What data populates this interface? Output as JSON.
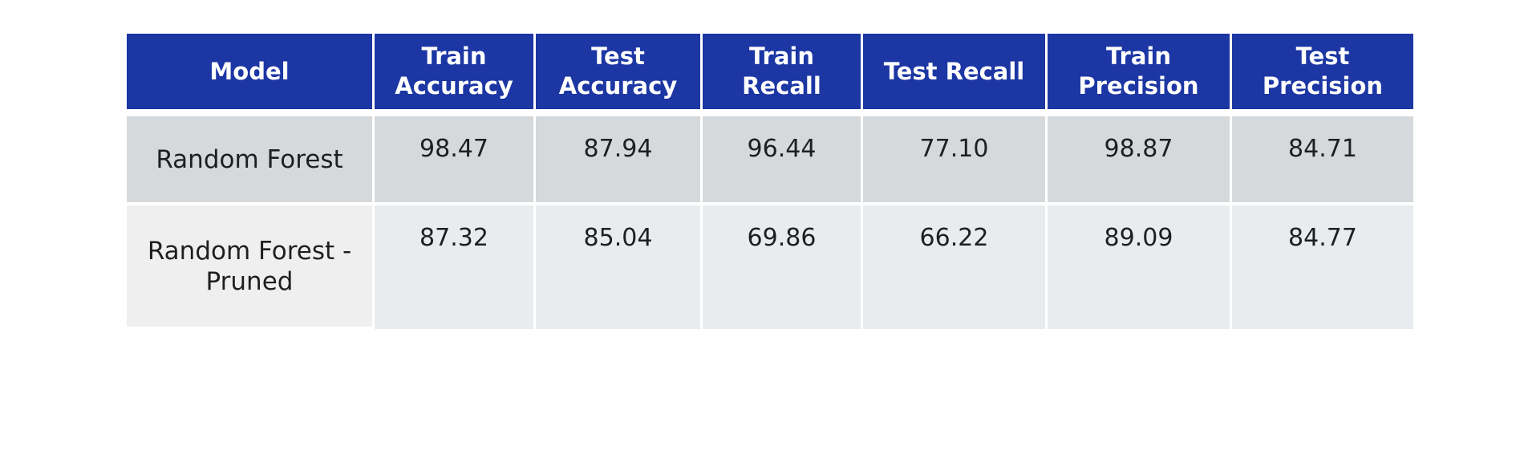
{
  "table": {
    "headers": [
      "Model",
      "Train\nAccuracy",
      "Test\nAccuracy",
      "Train\nRecall",
      "Test Recall",
      "Train\nPrecision",
      "Test\nPrecision"
    ],
    "rows": [
      {
        "model": "Random Forest",
        "values": [
          "98.47",
          "87.94",
          "96.44",
          "77.10",
          "98.87",
          "84.71"
        ]
      },
      {
        "model": "Random Forest -\nPruned",
        "values": [
          "87.32",
          "85.04",
          "69.86",
          "66.22",
          "89.09",
          "84.77"
        ]
      }
    ]
  },
  "colors": {
    "header_bg": "#1c36a3",
    "header_text": "#ffffff",
    "row1_bg": "#d5d9dc",
    "row2_bg": "#e9ecee",
    "row2_label_bg": "#efefef",
    "body_text": "#1f1f1f"
  }
}
